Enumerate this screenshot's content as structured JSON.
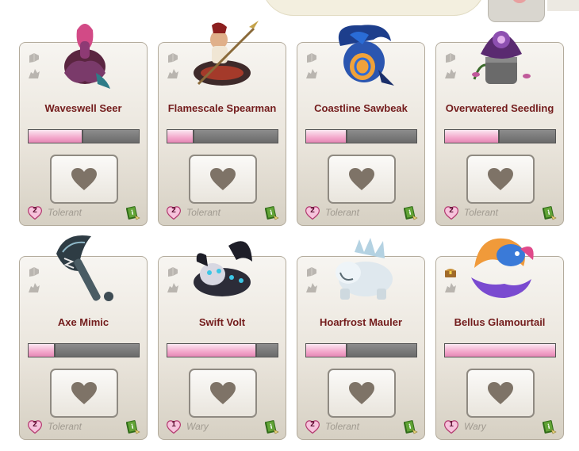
{
  "colors": {
    "name_text": "#731c1c",
    "bar_fill": "#f3a8cc",
    "bar_empty": "#7a7a7a",
    "heart": "#7e7367",
    "muted_text": "#a09a90"
  },
  "cards": [
    {
      "name": "Waveswell Seer",
      "level": "2",
      "temperament": "Tolerant",
      "progress": 0.48,
      "art": "mermaid-familiar-icon",
      "top_badge": "familiar-type-icon"
    },
    {
      "name": "Flamescale Spearman",
      "level": "2",
      "temperament": "Tolerant",
      "progress": 0.23,
      "art": "naga-spearman-familiar-icon",
      "top_badge": "familiar-type-icon"
    },
    {
      "name": "Coastline Sawbeak",
      "level": "2",
      "temperament": "Tolerant",
      "progress": 0.36,
      "art": "blue-bird-familiar-icon",
      "top_badge": "familiar-type-icon"
    },
    {
      "name": "Overwatered Seedling",
      "level": "2",
      "temperament": "Tolerant",
      "progress": 0.48,
      "art": "potted-plant-familiar-icon",
      "top_badge": "familiar-type-icon"
    },
    {
      "name": "Axe Mimic",
      "level": "2",
      "temperament": "Tolerant",
      "progress": 0.23,
      "art": "axe-mimic-familiar-icon",
      "top_badge": "familiar-type-icon"
    },
    {
      "name": "Swift Volt",
      "level": "1",
      "temperament": "Wary",
      "progress": 0.8,
      "art": "storm-wolf-familiar-icon",
      "top_badge": "familiar-type-icon"
    },
    {
      "name": "Hoarfrost Mauler",
      "level": "2",
      "temperament": "Tolerant",
      "progress": 0.36,
      "art": "ice-bear-familiar-icon",
      "top_badge": "familiar-type-icon"
    },
    {
      "name": "Bellus Glamourtail",
      "level": "1",
      "temperament": "Wary",
      "progress": 1.0,
      "art": "fish-familiar-icon",
      "top_badge": "treasure-chest-icon"
    }
  ]
}
